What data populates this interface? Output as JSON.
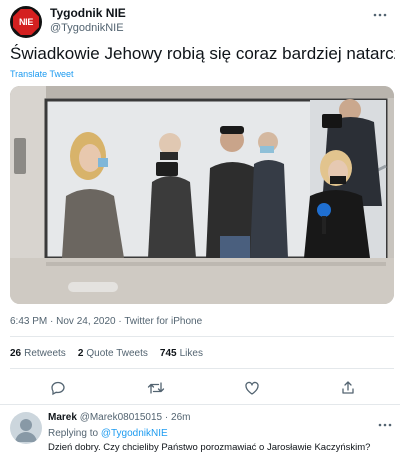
{
  "tweet": {
    "author": {
      "display_name": "Tygodnik NIE",
      "handle": "@TygodnikNIE",
      "logo_text": "NIE",
      "logo_color": "#d42020"
    },
    "text": "Świadkowie Jehowy robią się coraz bardziej natarczywi...",
    "translate_label": "Translate Tweet",
    "timestamp": "6:43 PM · Nov 24, 2020 · Twitter for iPhone",
    "stats": {
      "retweets_count": "26",
      "retweets_label": "Retweets",
      "quotes_count": "2",
      "quotes_label": "Quote Tweets",
      "likes_count": "745",
      "likes_label": "Likes"
    },
    "actions": [
      "reply-icon",
      "retweet-icon",
      "like-icon",
      "share-icon"
    ]
  },
  "reply": {
    "display_name": "Marek",
    "handle": "@Marek08015015",
    "time": "· 26m",
    "replying_label": "Replying to",
    "replying_handle": "@TygodnikNIE",
    "text": "Dzień dobry. Czy chcieliby Państwo porozmawiać o Jarosławie Kaczyńskim?"
  },
  "colors": {
    "accent": "#1d9bf0",
    "text": "#0f1419",
    "muted": "#536471"
  }
}
